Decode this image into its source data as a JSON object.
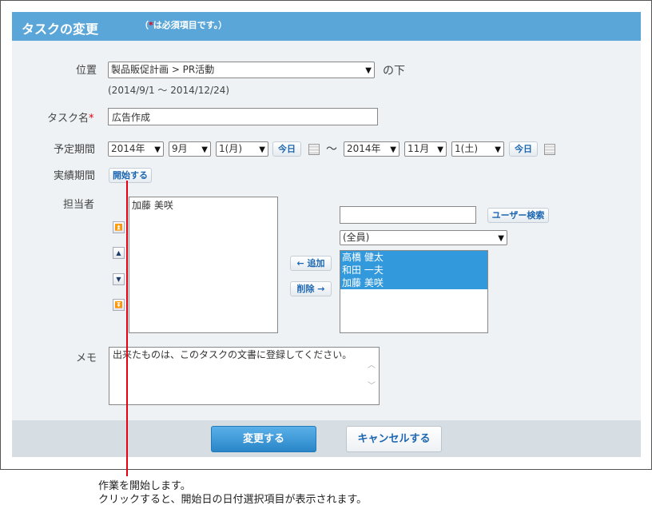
{
  "header": {
    "title": "タスクの変更",
    "required_note_open": "（",
    "required_star": "*",
    "required_note_text": "は必須項目です。）"
  },
  "form": {
    "position": {
      "label": "位置",
      "select_value": "製品販促計画 > PR活動",
      "suffix": "の下",
      "date_range": "(2014/9/1 ～ 2014/12/24)"
    },
    "task_name": {
      "label": "タスク名",
      "required_star": "*",
      "value": "広告作成"
    },
    "planned_period": {
      "label": "予定期間",
      "start_year": "2014年",
      "start_month": "9月",
      "start_day": "1(月)",
      "today_label": "今日",
      "tilde": "～",
      "end_year": "2014年",
      "end_month": "11月",
      "end_day": "1(土)"
    },
    "actual_period": {
      "label": "実績期間",
      "start_button": "開始する"
    },
    "assignee": {
      "label": "担当者",
      "selected": [
        "加藤 美咲"
      ],
      "add_button": "← 追加",
      "remove_button": "削除 →",
      "search_value": "",
      "search_button": "ユーザー検索",
      "group_select": "(全員)",
      "candidates": [
        "高橋 健太",
        "和田 一夫",
        "加藤 美咲"
      ]
    },
    "memo": {
      "label": "メモ",
      "value": "出来たものは、このタスクの文書に登録してください。"
    }
  },
  "footer": {
    "submit_button": "変更する",
    "cancel_button": "キャンセルする"
  },
  "callout": {
    "line1": "作業を開始します。",
    "line2": "クリックすると、開始日の日付選択項目が表示されます。"
  },
  "colors": {
    "header_bg": "#5aa6d8",
    "required_star": "#e60012",
    "primary_button": "#2a86c8",
    "list_selection": "#3399dd",
    "callout_line": "#e60012"
  }
}
